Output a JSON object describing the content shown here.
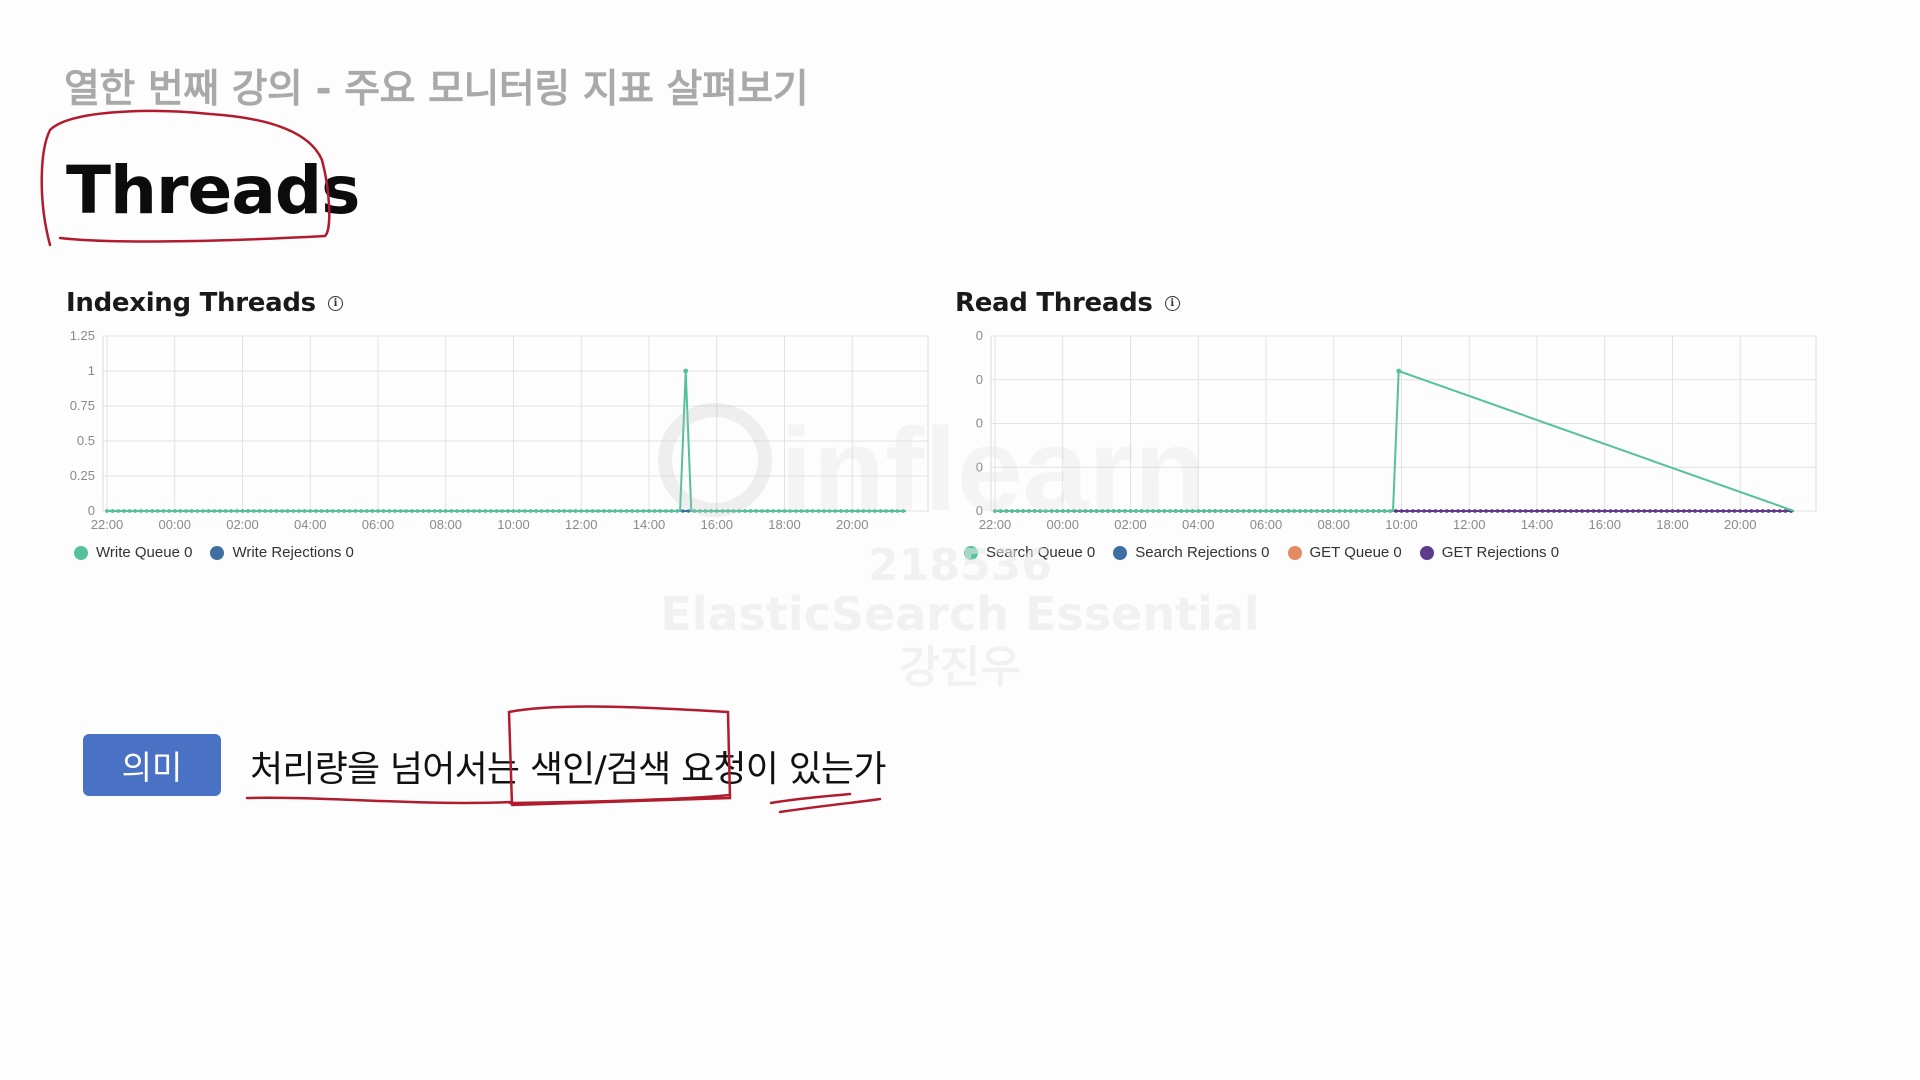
{
  "header": {
    "lecture_title": "열한 번째 강의 - 주요 모니터링 지표 살펴보기",
    "section_title": "Threads"
  },
  "panels": [
    {
      "title": "Indexing Threads",
      "legend": [
        {
          "label": "Write Queue 0",
          "color": "#54c19c"
        },
        {
          "label": "Write Rejections 0",
          "color": "#3e6ea2"
        }
      ]
    },
    {
      "title": "Read Threads",
      "legend": [
        {
          "label": "Search Queue 0",
          "color": "#54c19c"
        },
        {
          "label": "Search Rejections 0",
          "color": "#3e6ea2"
        },
        {
          "label": "GET Queue 0",
          "color": "#e38a62"
        },
        {
          "label": "GET Rejections 0",
          "color": "#5d3a8c"
        }
      ]
    }
  ],
  "chart_data": [
    {
      "type": "line",
      "title": "Indexing Threads",
      "x_ticks": [
        "22:00",
        "00:00",
        "02:00",
        "04:00",
        "06:00",
        "08:00",
        "10:00",
        "12:00",
        "14:00",
        "16:00",
        "18:00",
        "20:00"
      ],
      "y_ticks": [
        "0",
        "0.25",
        "0.5",
        "0.75",
        "1",
        "1.25"
      ],
      "ylim": [
        0,
        1.25
      ],
      "grid": true,
      "legend_position": "bottom-left",
      "series": [
        {
          "name": "Write Queue",
          "color": "#54c19c",
          "x": [
            "22:00",
            "14:55",
            "15:05",
            "15:15",
            "21:35"
          ],
          "values": [
            0,
            0,
            1,
            0,
            0
          ]
        },
        {
          "name": "Write Rejections",
          "color": "#3e6ea2",
          "x": [
            "22:00",
            "21:35"
          ],
          "values": [
            0,
            0
          ]
        }
      ]
    },
    {
      "type": "line",
      "title": "Read Threads",
      "x_ticks": [
        "22:00",
        "00:00",
        "02:00",
        "04:00",
        "06:00",
        "08:00",
        "10:00",
        "12:00",
        "14:00",
        "16:00",
        "18:00",
        "20:00"
      ],
      "y_ticks": [
        "0",
        "0",
        "0",
        "0",
        "0"
      ],
      "grid": true,
      "legend_position": "bottom-left",
      "series": [
        {
          "name": "Search Queue",
          "color": "#54c19c",
          "x": [
            "22:00",
            "09:45",
            "09:55",
            "21:35"
          ],
          "values": [
            0,
            0,
            0.8,
            0
          ]
        },
        {
          "name": "Search Rejections",
          "color": "#3e6ea2",
          "x": [
            "22:00",
            "21:35"
          ],
          "values": [
            0,
            0
          ]
        },
        {
          "name": "GET Queue",
          "color": "#e38a62",
          "x": [
            "22:00",
            "21:35"
          ],
          "values": [
            0,
            0
          ]
        },
        {
          "name": "GET Rejections",
          "color": "#5d3a8c",
          "x": [
            "22:00",
            "21:35"
          ],
          "values": [
            0,
            0
          ]
        }
      ]
    }
  ],
  "meaning": {
    "badge_label": "의미",
    "text": "처리량을 넘어서는 색인/검색 요청이 있는가"
  },
  "watermark": {
    "logo_text": "inflearn",
    "id": "218536",
    "course": "ElasticSearch Essential",
    "author": "강진우"
  }
}
